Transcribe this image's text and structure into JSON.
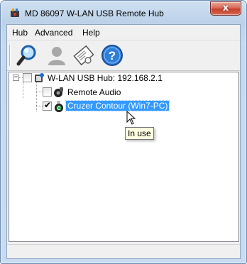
{
  "window": {
    "title": "MD 86097 W-LAN USB Remote Hub",
    "close_glyph": "x"
  },
  "menu": {
    "items": [
      "Hub",
      "Advanced",
      "Help"
    ]
  },
  "toolbar": {
    "buttons": [
      {
        "icon": "magnifier-icon"
      },
      {
        "icon": "user-icon"
      },
      {
        "icon": "certificate-icon"
      },
      {
        "icon": "help-icon"
      }
    ]
  },
  "tree": {
    "hub": {
      "label": "W-LAN USB Hub: 192.168.2.1",
      "expander": "−",
      "checked": false
    },
    "children": [
      {
        "label": "Remote Audio",
        "checked": false,
        "selected": false
      },
      {
        "label": "Cruzer Contour (Win7-PC)",
        "checked": true,
        "selected": true
      }
    ]
  },
  "tooltip": {
    "text": "In use"
  },
  "colors": {
    "selection": "#3399ff",
    "tooltip_bg": "#ffffe1",
    "close_button": "#c4402e"
  }
}
